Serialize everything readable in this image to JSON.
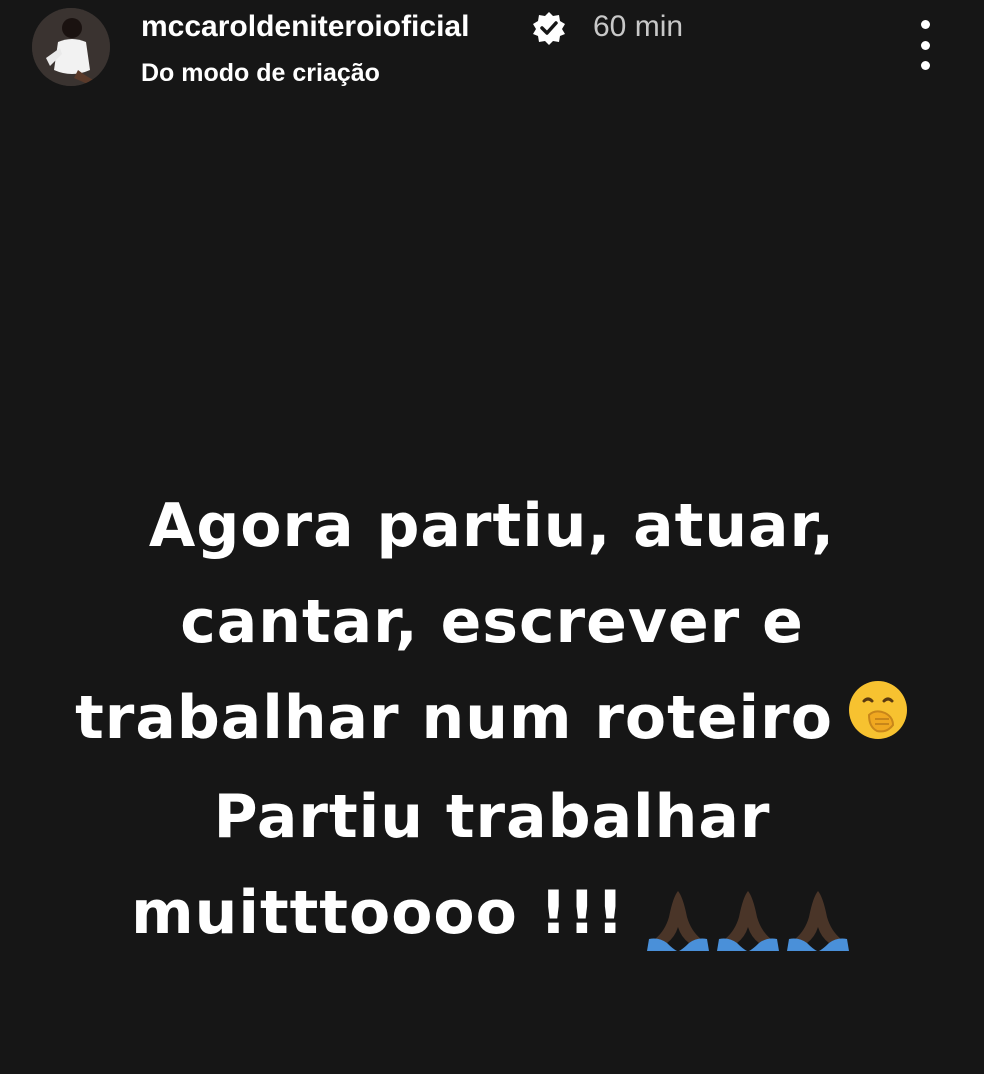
{
  "header": {
    "username": "mccaroldeniteroioficial",
    "verified_icon": "verified-badge-icon",
    "time": "60 min",
    "subtitle": "Do modo de criação",
    "more_icon": "more-vertical-icon"
  },
  "story": {
    "background_color": "#161616",
    "text_lines": [
      "Agora partiu, atuar,",
      "cantar, escrever e",
      "trabalhar num roteiro",
      "Partiu trabalhar",
      "muitttoooo !!!"
    ],
    "emoji_line3": "face-with-hand-over-mouth-icon",
    "emoji_line5": [
      "folded-hands-icon",
      "folded-hands-icon",
      "folded-hands-icon"
    ]
  }
}
